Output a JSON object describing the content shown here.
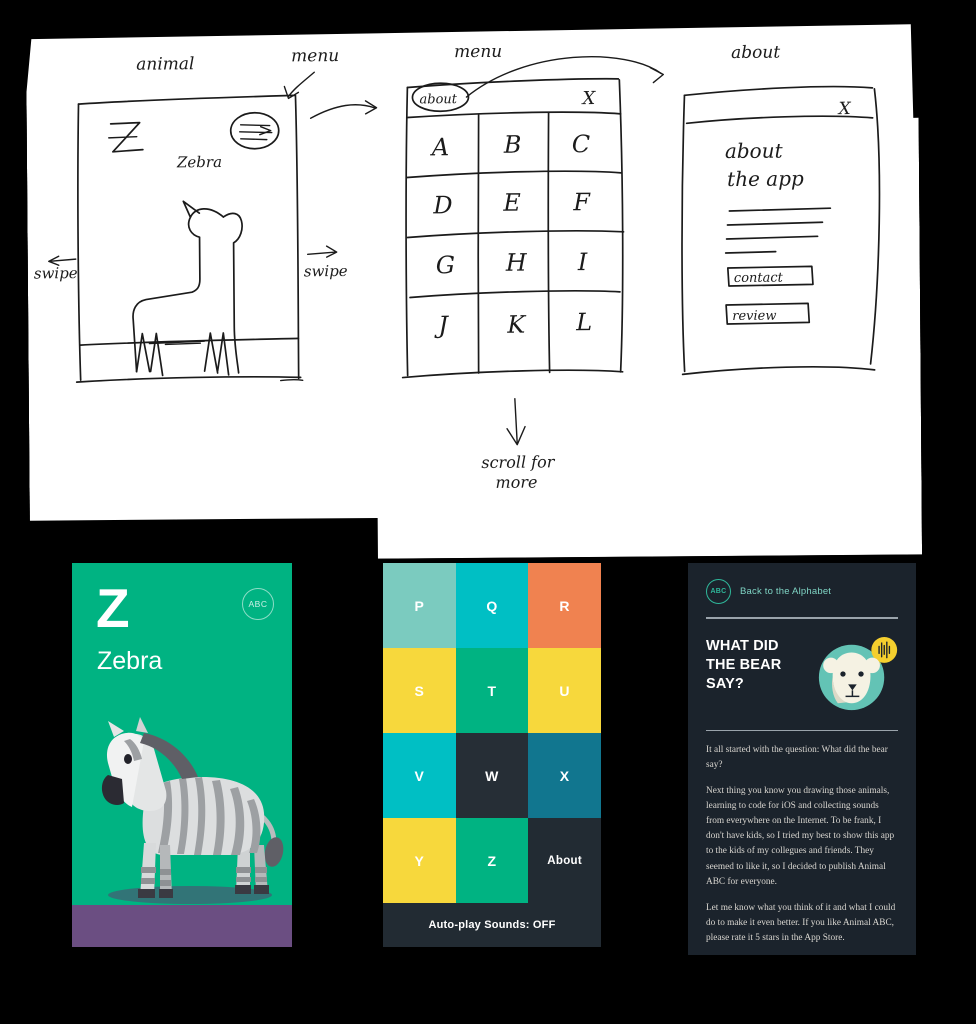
{
  "canvas": {
    "background": "#000000"
  },
  "sketch": {
    "paper_color": "#ffffff",
    "ink_color": "#1b1b1b",
    "annotations": {
      "animal": "animal",
      "menu_left": "menu",
      "menu_mid": "menu",
      "about_right": "about",
      "swipe_left": "swipe",
      "swipe_right": "swipe",
      "scroll_for_more_line1": "scroll for",
      "scroll_for_more_line2": "more"
    },
    "frame_animal": {
      "letter": "Z",
      "name": "Zebra"
    },
    "frame_menu": {
      "about_chip": "about",
      "close": "X",
      "letters": [
        "A",
        "B",
        "C",
        "D",
        "E",
        "F",
        "G",
        "H",
        "I",
        "J",
        "K",
        "L"
      ]
    },
    "frame_about": {
      "close": "X",
      "title_line1": "about",
      "title_line2": "the app",
      "button_contact": "contact",
      "button_review": "review"
    }
  },
  "screens": {
    "zebra_card": {
      "letter": "Z",
      "animal_name": "Zebra",
      "abc_badge": "ABC",
      "bg_color": "#00b382",
      "ground_color": "#6b4e82"
    },
    "alphabet_grid": {
      "bg_color": "#222b33",
      "tiles": [
        {
          "label": "P",
          "color": "#7bcbbf"
        },
        {
          "label": "Q",
          "color": "#00bfc4"
        },
        {
          "label": "R",
          "color": "#f08250"
        },
        {
          "label": "S",
          "color": "#f7d83c"
        },
        {
          "label": "T",
          "color": "#00b382"
        },
        {
          "label": "U",
          "color": "#f7d83c"
        },
        {
          "label": "V",
          "color": "#00bfc4"
        },
        {
          "label": "W",
          "color": "#262e36"
        },
        {
          "label": "X",
          "color": "#11768f"
        },
        {
          "label": "Y",
          "color": "#f7d83c"
        },
        {
          "label": "Z",
          "color": "#00b382"
        },
        {
          "label": "About",
          "color": "#222b33"
        }
      ],
      "autoplay_label": "Auto-play Sounds: OFF"
    },
    "about_page": {
      "bg_color": "#1b232c",
      "abc_badge": "ABC",
      "nav_label": "Back to the Alphabet",
      "title": "WHAT DID THE BEAR SAY?",
      "accent_color": "#2fb79a",
      "bubble_color": "#f5cf2e",
      "paragraphs": [
        "It all started with the question: What did the bear say?",
        "Next thing you know you drawing those animals, learning to code for iOS and collecting sounds from everywhere on the Internet. To be frank, I don't have kids, so I tried my best to show this app to the kids of my collegues and friends. They seemed to like it, so I decided to publish Animal ABC for everyone.",
        "Let me know what you think of it and what I could do to make it even better. If you like Animal ABC, please rate it 5 stars in the App Store."
      ]
    }
  }
}
